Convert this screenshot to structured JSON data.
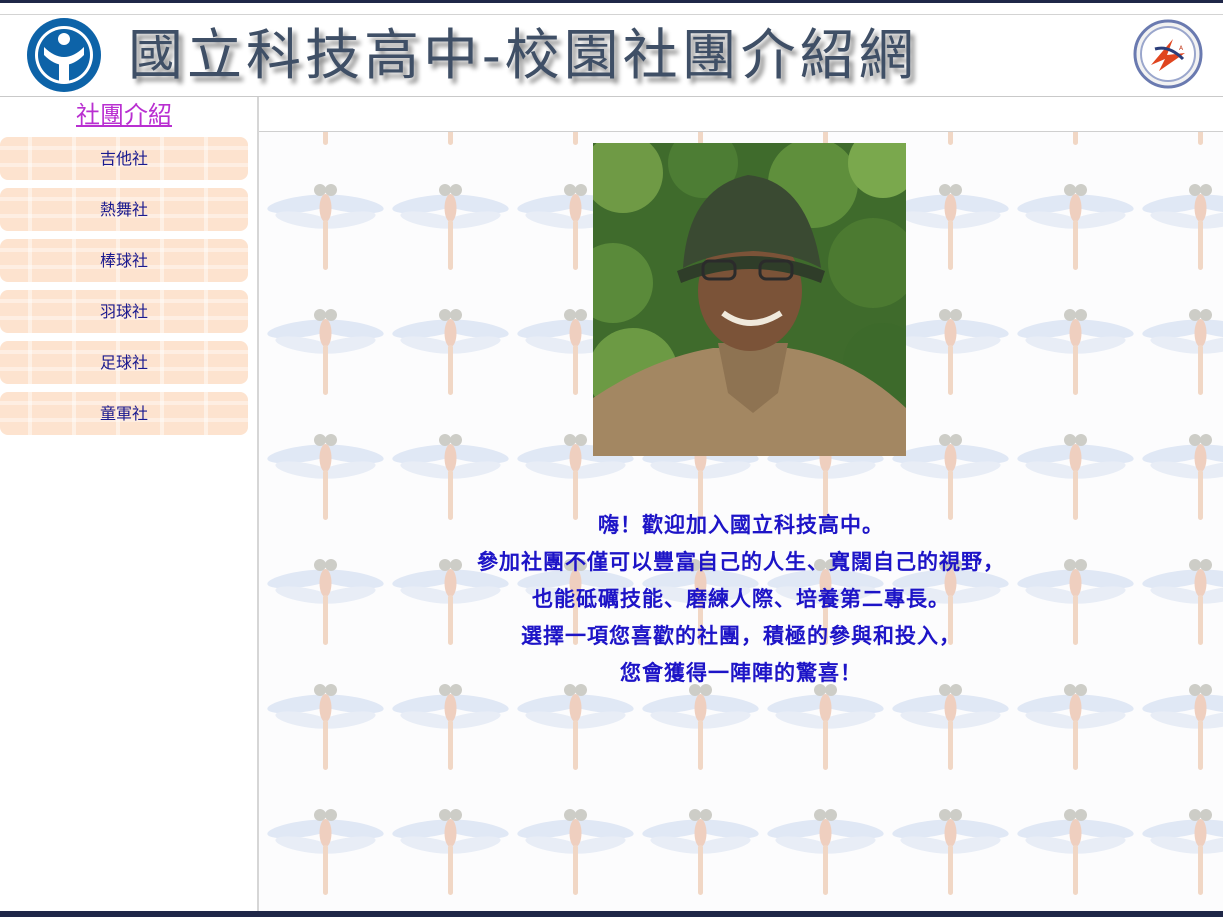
{
  "header": {
    "title": "國立科技高中-校園社團介紹網",
    "left_logo": "school-emblem-icon",
    "right_logo": "red-star-emblem-icon"
  },
  "sidebar": {
    "title": "社團介紹",
    "items": [
      {
        "label": "吉他社"
      },
      {
        "label": "熱舞社"
      },
      {
        "label": "棒球社"
      },
      {
        "label": "羽球社"
      },
      {
        "label": "足球社"
      },
      {
        "label": "童軍社"
      }
    ]
  },
  "main": {
    "welcome_lines": [
      "嗨！歡迎加入國立科技高中。",
      "參加社團不僅可以豐富自己的人生、寬闊自己的視野，",
      "也能砥礪技能、磨練人際、培養第二專長。",
      "選擇一項您喜歡的社團，積極的參與和投入，",
      "您會獲得一陣陣的驚喜！"
    ]
  },
  "colors": {
    "title_text": "#3f4f66",
    "sidebar_title": "#b92fd1",
    "button_bg": "#fde3cf",
    "button_text": "#1a1a8f",
    "welcome_text": "#1d14c7",
    "frame_bar": "#1f2748"
  }
}
